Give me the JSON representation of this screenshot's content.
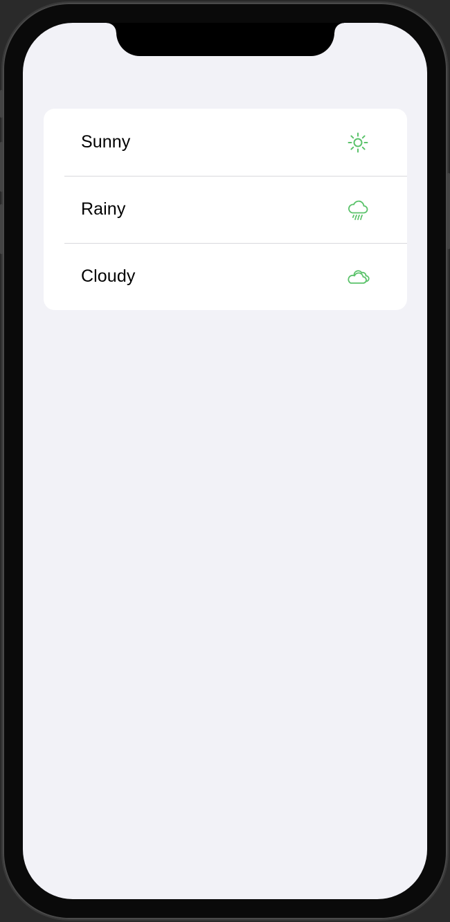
{
  "weather_list": {
    "items": [
      {
        "label": "Sunny",
        "icon": "sun-icon"
      },
      {
        "label": "Rainy",
        "icon": "cloud-rain-icon"
      },
      {
        "label": "Cloudy",
        "icon": "cloud-icon"
      }
    ]
  },
  "colors": {
    "accent": "#5ac26a",
    "background": "#f2f2f7",
    "card": "#ffffff",
    "separator": "#d8d8dc",
    "text": "#000000"
  }
}
